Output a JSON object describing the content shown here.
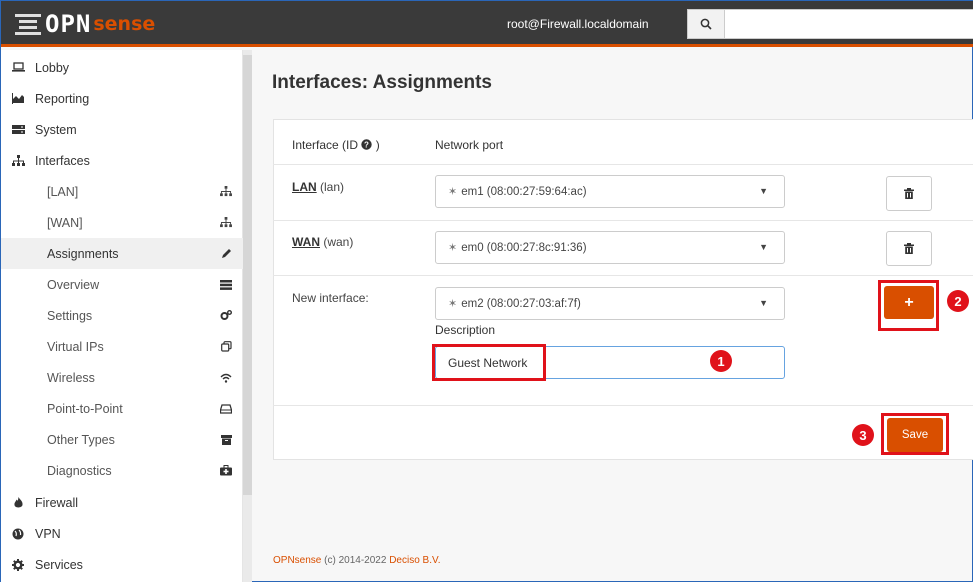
{
  "header": {
    "brand_opn": "OPN",
    "brand_sense": "sense",
    "user": "root@Firewall.localdomain",
    "search_icon": "search-icon",
    "search_placeholder": ""
  },
  "sidebar": {
    "top_items": [
      {
        "label": "Lobby",
        "icon": "laptop-icon"
      },
      {
        "label": "Reporting",
        "icon": "area-chart-icon"
      },
      {
        "label": "System",
        "icon": "server-icon"
      },
      {
        "label": "Interfaces",
        "icon": "sitemap-icon"
      }
    ],
    "interface_items": [
      {
        "label": "[LAN]",
        "icon": "sitemap-icon"
      },
      {
        "label": "[WAN]",
        "icon": "sitemap-icon"
      },
      {
        "label": "Assignments",
        "icon": "pencil-icon"
      },
      {
        "label": "Overview",
        "icon": "tasks-icon"
      },
      {
        "label": "Settings",
        "icon": "cogs-icon"
      },
      {
        "label": "Virtual IPs",
        "icon": "clone-icon"
      },
      {
        "label": "Wireless",
        "icon": "wifi-icon"
      },
      {
        "label": "Point-to-Point",
        "icon": "hdd-icon"
      },
      {
        "label": "Other Types",
        "icon": "archive-icon"
      },
      {
        "label": "Diagnostics",
        "icon": "medkit-icon"
      }
    ],
    "bottom_items": [
      {
        "label": "Firewall",
        "icon": "fire-icon"
      },
      {
        "label": "VPN",
        "icon": "globe-icon"
      },
      {
        "label": "Services",
        "icon": "cog-icon"
      }
    ]
  },
  "main": {
    "title": "Interfaces: Assignments",
    "columns": {
      "interface": "Interface (ID",
      "interface_close": ")",
      "network_port": "Network port"
    },
    "rows": [
      {
        "name": "LAN",
        "id": "(lan)",
        "port": "em1 (08:00:27:59:64:ac)"
      },
      {
        "name": "WAN",
        "id": "(wan)",
        "port": "em0 (08:00:27:8c:91:36)"
      }
    ],
    "new_interface": {
      "label": "New interface:",
      "port": "em2 (08:00:27:03:af:7f)",
      "description_label": "Description",
      "description_value": "Guest Network",
      "add_label": "+"
    },
    "save_label": "Save",
    "badges": [
      "1",
      "2",
      "3"
    ],
    "highlight_color": "#e0121a",
    "accent_color": "#d94f00"
  },
  "footer": {
    "brand": "OPNsense",
    "copyright": " (c) 2014-2022 ",
    "company": "Deciso B.V."
  }
}
